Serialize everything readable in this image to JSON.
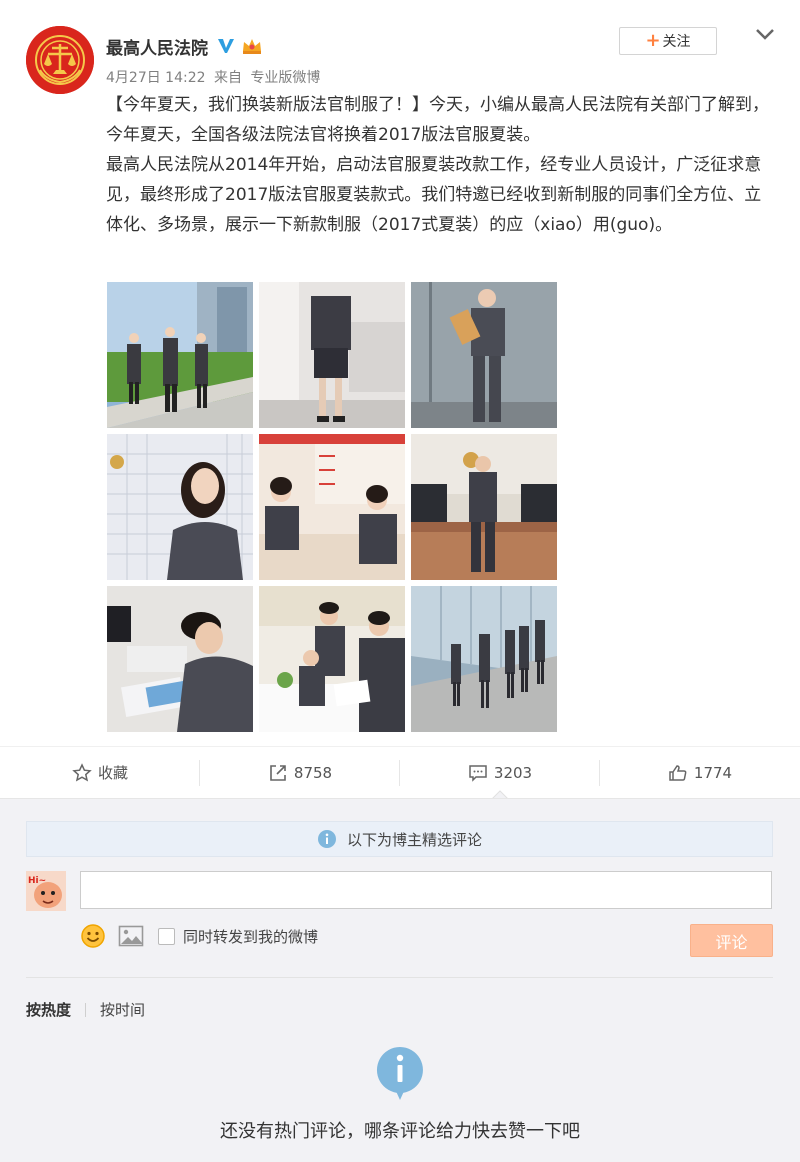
{
  "post": {
    "author": "最高人民法院",
    "timestamp": "4月27日 14:22",
    "source_prefix": "来自",
    "source": "专业版微博",
    "follow_plus": "+",
    "follow_label": "关注",
    "paragraphs": [
      "【今年夏天，我们换装新版法官制服了！】今天，小编从最高人民法院有关部门了解到，今年夏天，全国各级法院法官将换着2017版法官服夏装。",
      "最高人民法院从2014年开始，启动法官服夏装改款工作，经专业人员设计，广泛征求意见，最终形成了2017版法官服夏装款式。我们特邀已经收到新制服的同事们全方位、立体化、多场景，展示一下新款制服（2017式夏装）的应（xiao）用(guo)。"
    ],
    "photos_count": 9
  },
  "actions": {
    "favorite_label": "收藏",
    "repost_count": "8758",
    "comment_count": "3203",
    "like_count": "1774"
  },
  "comments": {
    "notice": "以下为博主精选评论",
    "input_value": "",
    "repost_label": "同时转发到我的微博",
    "submit_label": "评论",
    "sort_hot": "按热度",
    "sort_time": "按时间",
    "empty_text": "还没有热门评论，哪条评论给力快去赞一下吧"
  },
  "colors": {
    "accent": "#ff8140",
    "submit_disabled": "#ffc09f",
    "notice_icon": "#7fb7dd",
    "verified": "#2d9ee0"
  }
}
